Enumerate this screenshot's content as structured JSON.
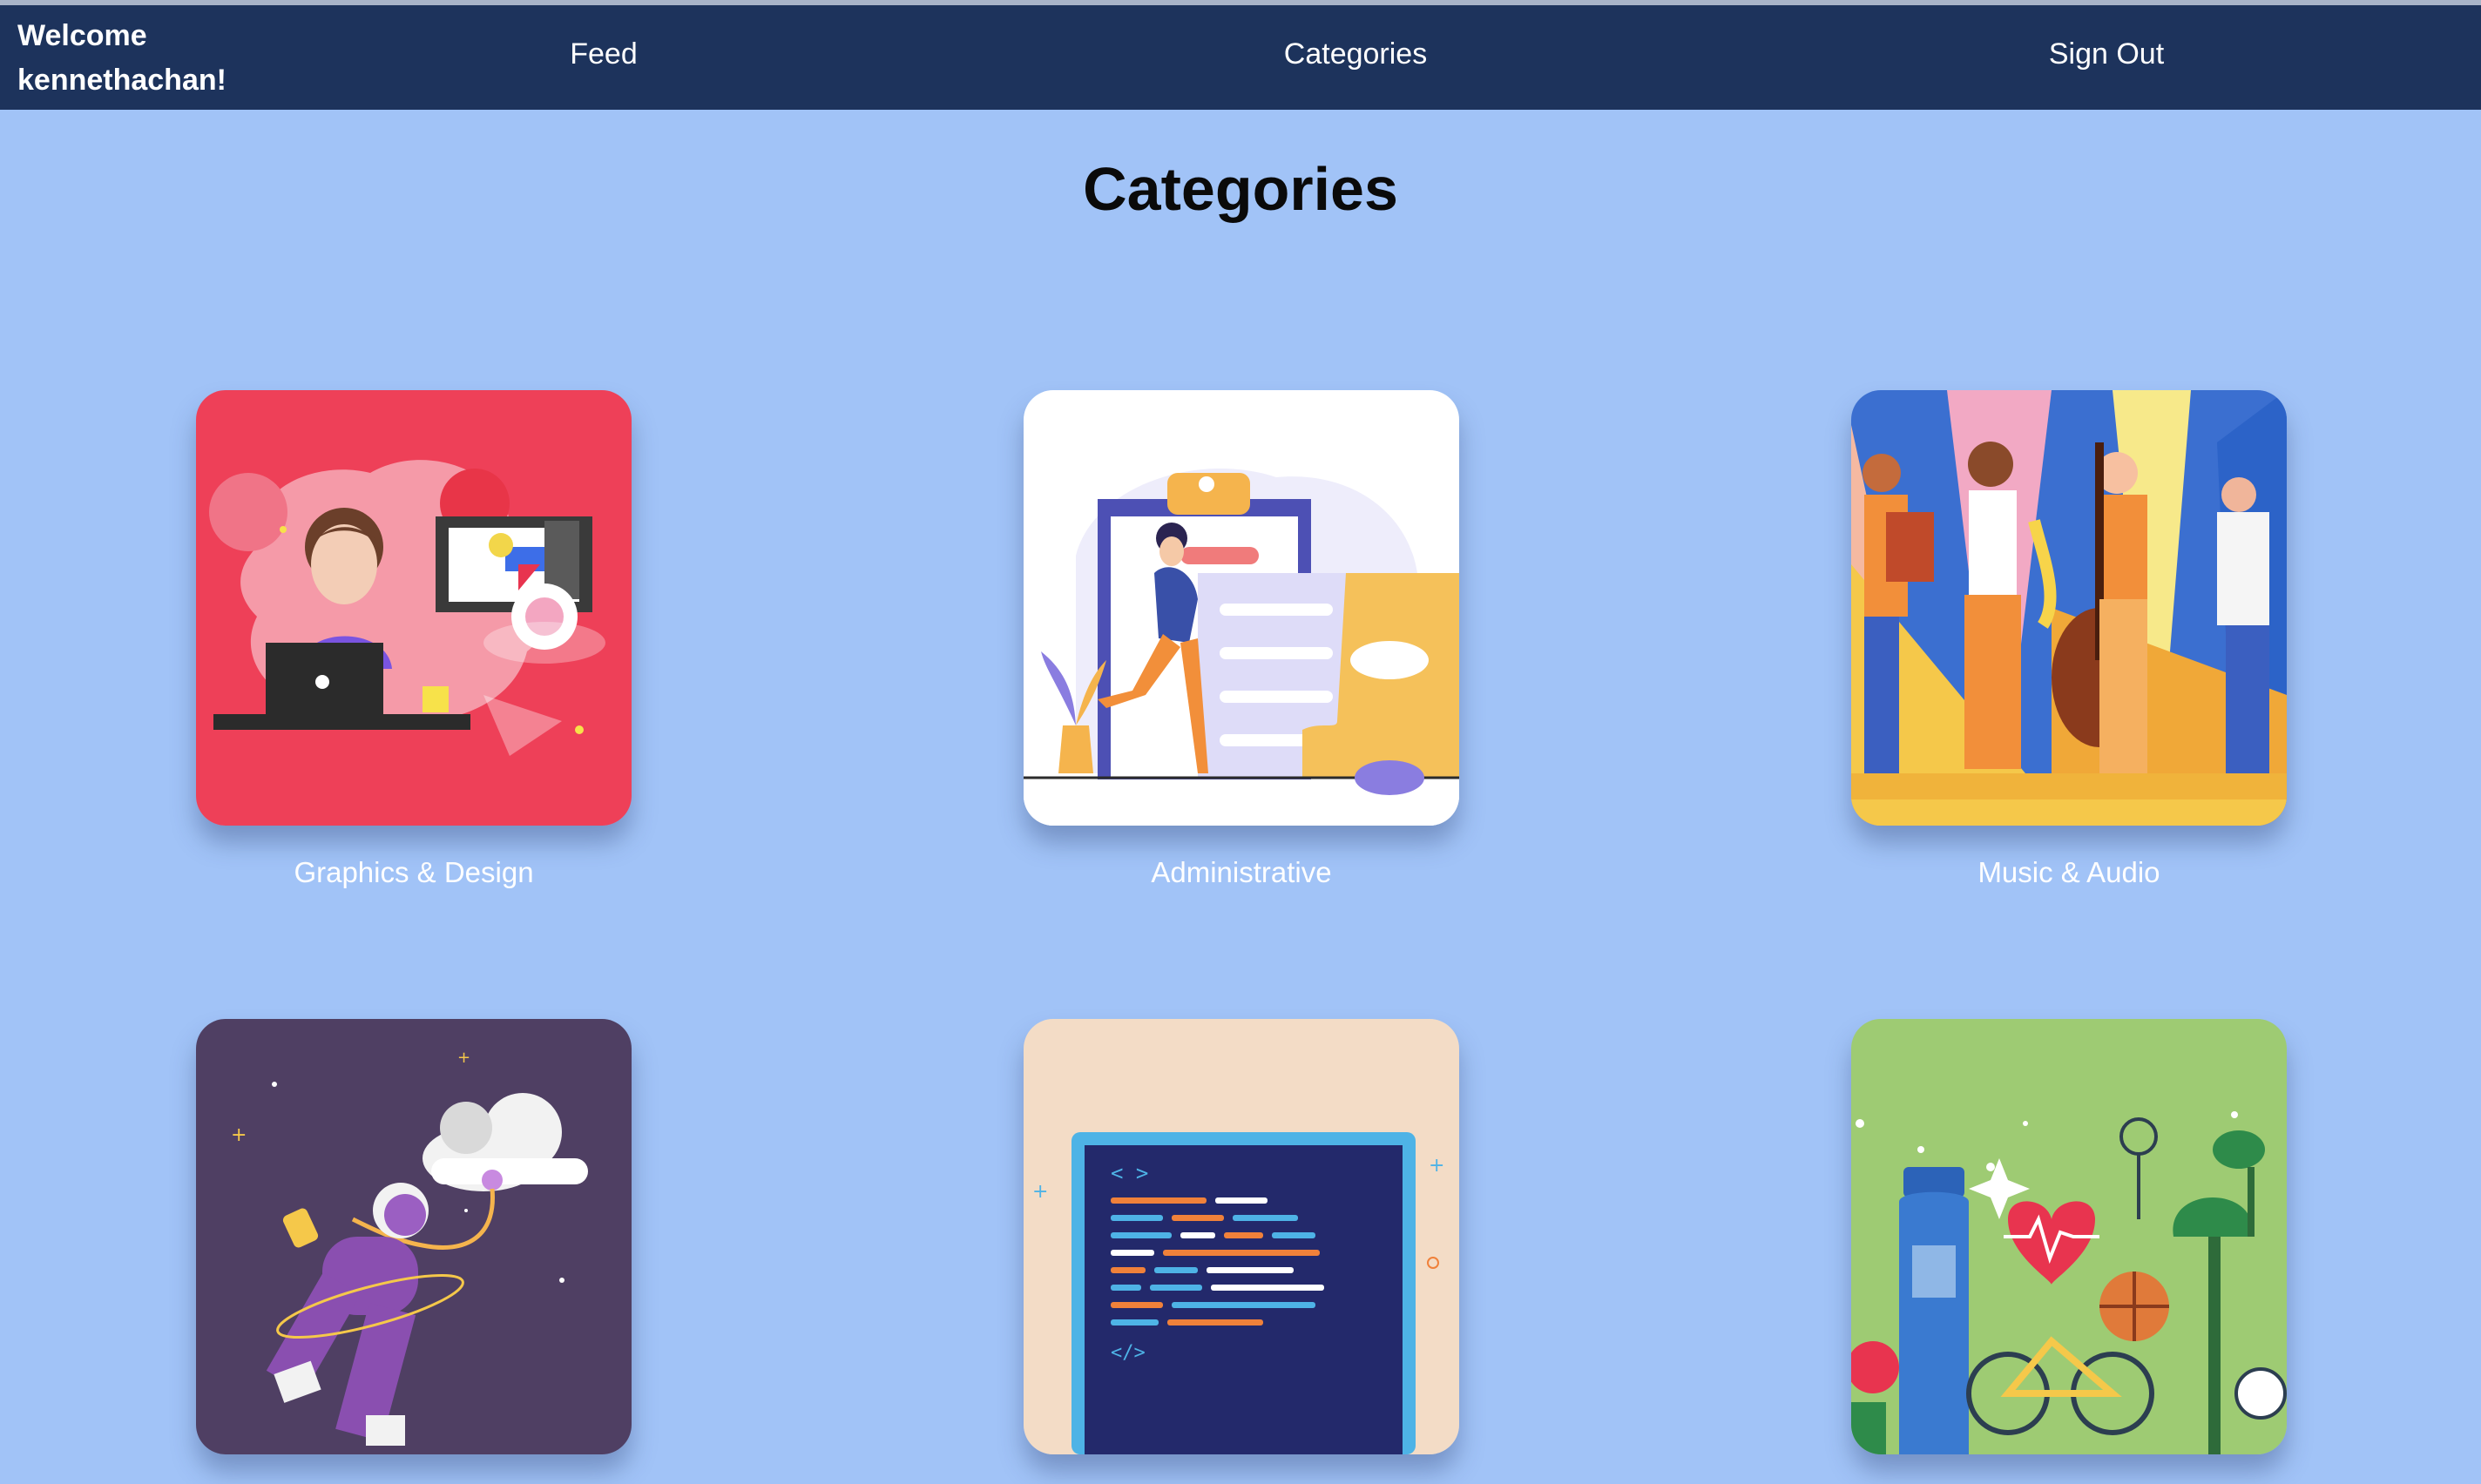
{
  "navbar": {
    "welcome_line1": "Welcome",
    "welcome_line2": "kennethachan!",
    "links": [
      "Feed",
      "Categories",
      "Sign Out"
    ]
  },
  "page": {
    "title": "Categories"
  },
  "categories": [
    {
      "label": "Graphics & Design",
      "bg": "#ee4058",
      "icon": "designer-illustration"
    },
    {
      "label": "Administrative",
      "bg": "#ffffff",
      "icon": "clipboard-illustration"
    },
    {
      "label": "Music & Audio",
      "bg": "#3b6fd0",
      "icon": "band-illustration"
    },
    {
      "label": "",
      "bg": "#4f3f63",
      "icon": "astronaut-illustration"
    },
    {
      "label": "",
      "bg": "#f3dcc6",
      "icon": "code-screen-illustration"
    },
    {
      "label": "",
      "bg": "#9ecb73",
      "icon": "lifestyle-illustration"
    }
  ],
  "colors": {
    "navbar": "#1d335c",
    "page_background": "#a1c3f7"
  }
}
